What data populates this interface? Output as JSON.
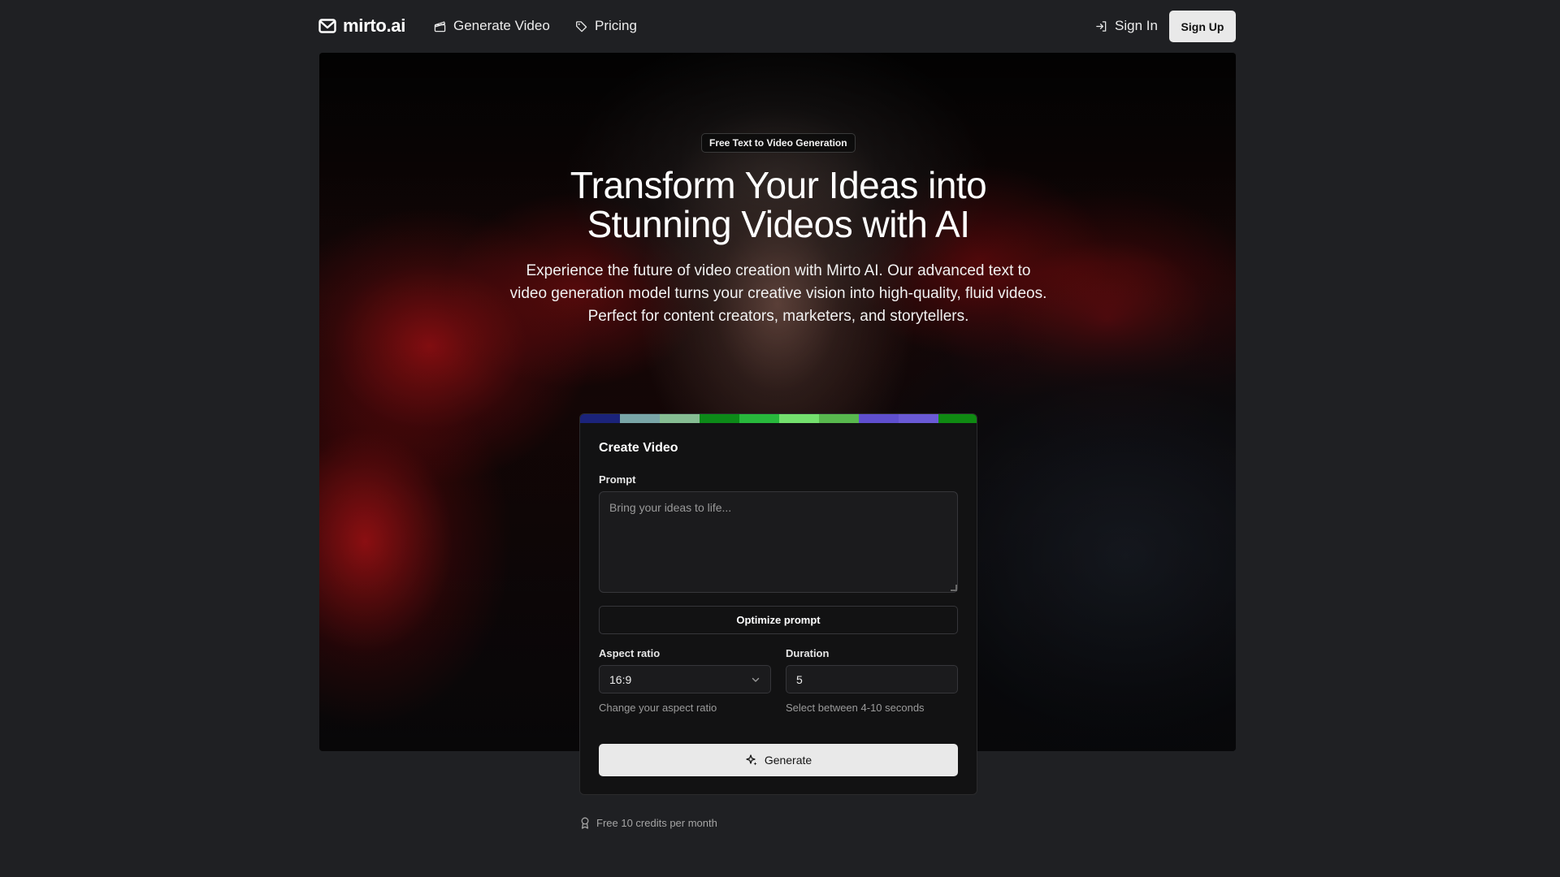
{
  "header": {
    "brand": "mirto.ai",
    "nav": [
      {
        "label": "Generate Video",
        "icon": "clapperboard-icon"
      },
      {
        "label": "Pricing",
        "icon": "tag-icon"
      }
    ],
    "sign_in": "Sign In",
    "sign_up": "Sign Up"
  },
  "hero": {
    "badge": "Free Text to Video Generation",
    "headline_line1": "Transform Your Ideas into",
    "headline_line2": "Stunning Videos with AI",
    "description": "Experience the future of video creation with Mirto AI. Our advanced text to video generation model turns your creative vision into high-quality, fluid videos. Perfect for content creators, marketers, and storytellers."
  },
  "form": {
    "title": "Create Video",
    "prompt_label": "Prompt",
    "prompt_placeholder": "Bring your ideas to life...",
    "optimize_label": "Optimize prompt",
    "aspect_label": "Aspect ratio",
    "aspect_value": "16:9",
    "aspect_hint": "Change your aspect ratio",
    "duration_label": "Duration",
    "duration_value": "5",
    "duration_hint": "Select between 4-10 seconds",
    "generate_label": "Generate"
  },
  "footer_note": "Free 10 credits per month",
  "colors": {
    "background": "#1f2023",
    "card": "#121213",
    "button_light": "#e9e9e9",
    "strip": [
      "#1b237a",
      "#7aa6a8",
      "#86bd93",
      "#0c8a18",
      "#28b83c",
      "#74e06e",
      "#58b84e",
      "#5f4fcf",
      "#6a5ad6",
      "#0f8a12"
    ]
  }
}
